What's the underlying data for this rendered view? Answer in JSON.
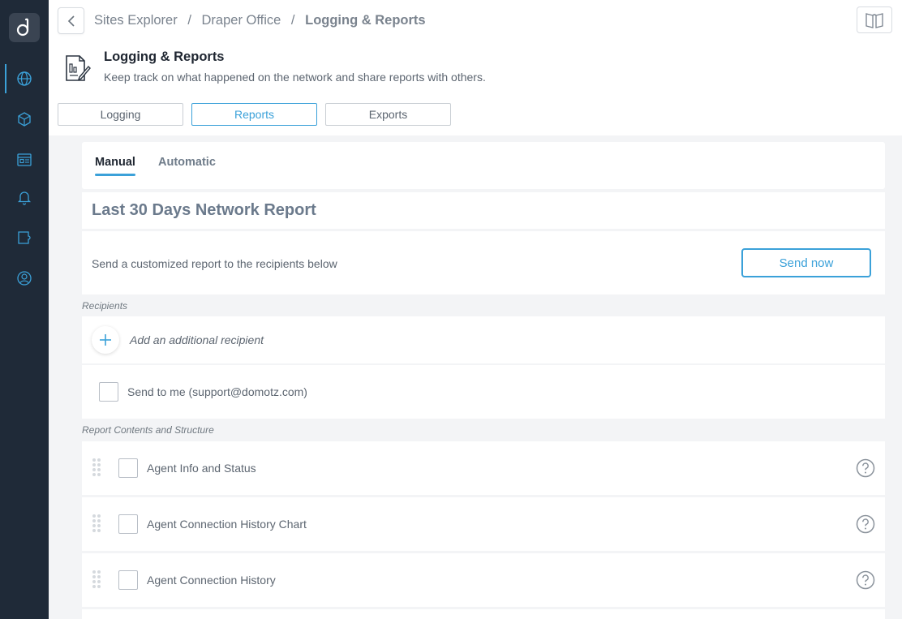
{
  "rail": {
    "logo_letter": "d",
    "items": [
      {
        "icon": "globe-icon",
        "active": true
      },
      {
        "icon": "cubes-icon",
        "active": false
      },
      {
        "icon": "dashboard-icon",
        "active": false
      },
      {
        "icon": "bell-icon",
        "active": false
      },
      {
        "icon": "puzzle-icon",
        "active": false
      },
      {
        "icon": "user-icon",
        "active": false
      }
    ]
  },
  "breadcrumb": {
    "items": [
      "Sites Explorer",
      "Draper Office"
    ],
    "separator": "/",
    "current": "Logging & Reports"
  },
  "page": {
    "title": "Logging & Reports",
    "subtitle": "Keep track on what happened on the network and share reports with others."
  },
  "segments": [
    {
      "label": "Logging",
      "active": false
    },
    {
      "label": "Reports",
      "active": true
    },
    {
      "label": "Exports",
      "active": false
    }
  ],
  "tabs": {
    "manual": "Manual",
    "automatic": "Automatic"
  },
  "report": {
    "title": "Last 30 Days Network Report",
    "send_text": "Send a customized report to the recipients below",
    "send_button": "Send now"
  },
  "recipients": {
    "label": "Recipients",
    "add_text": "Add an additional recipient",
    "send_to_me": "Send to me (support@domotz.com)"
  },
  "contents": {
    "label": "Report Contents and Structure",
    "rows": [
      "Agent Info and Status",
      "Agent Connection History Chart",
      "Agent Connection History"
    ]
  },
  "colors": {
    "accent": "#3ba1d9",
    "rail": "#1f2a38"
  }
}
